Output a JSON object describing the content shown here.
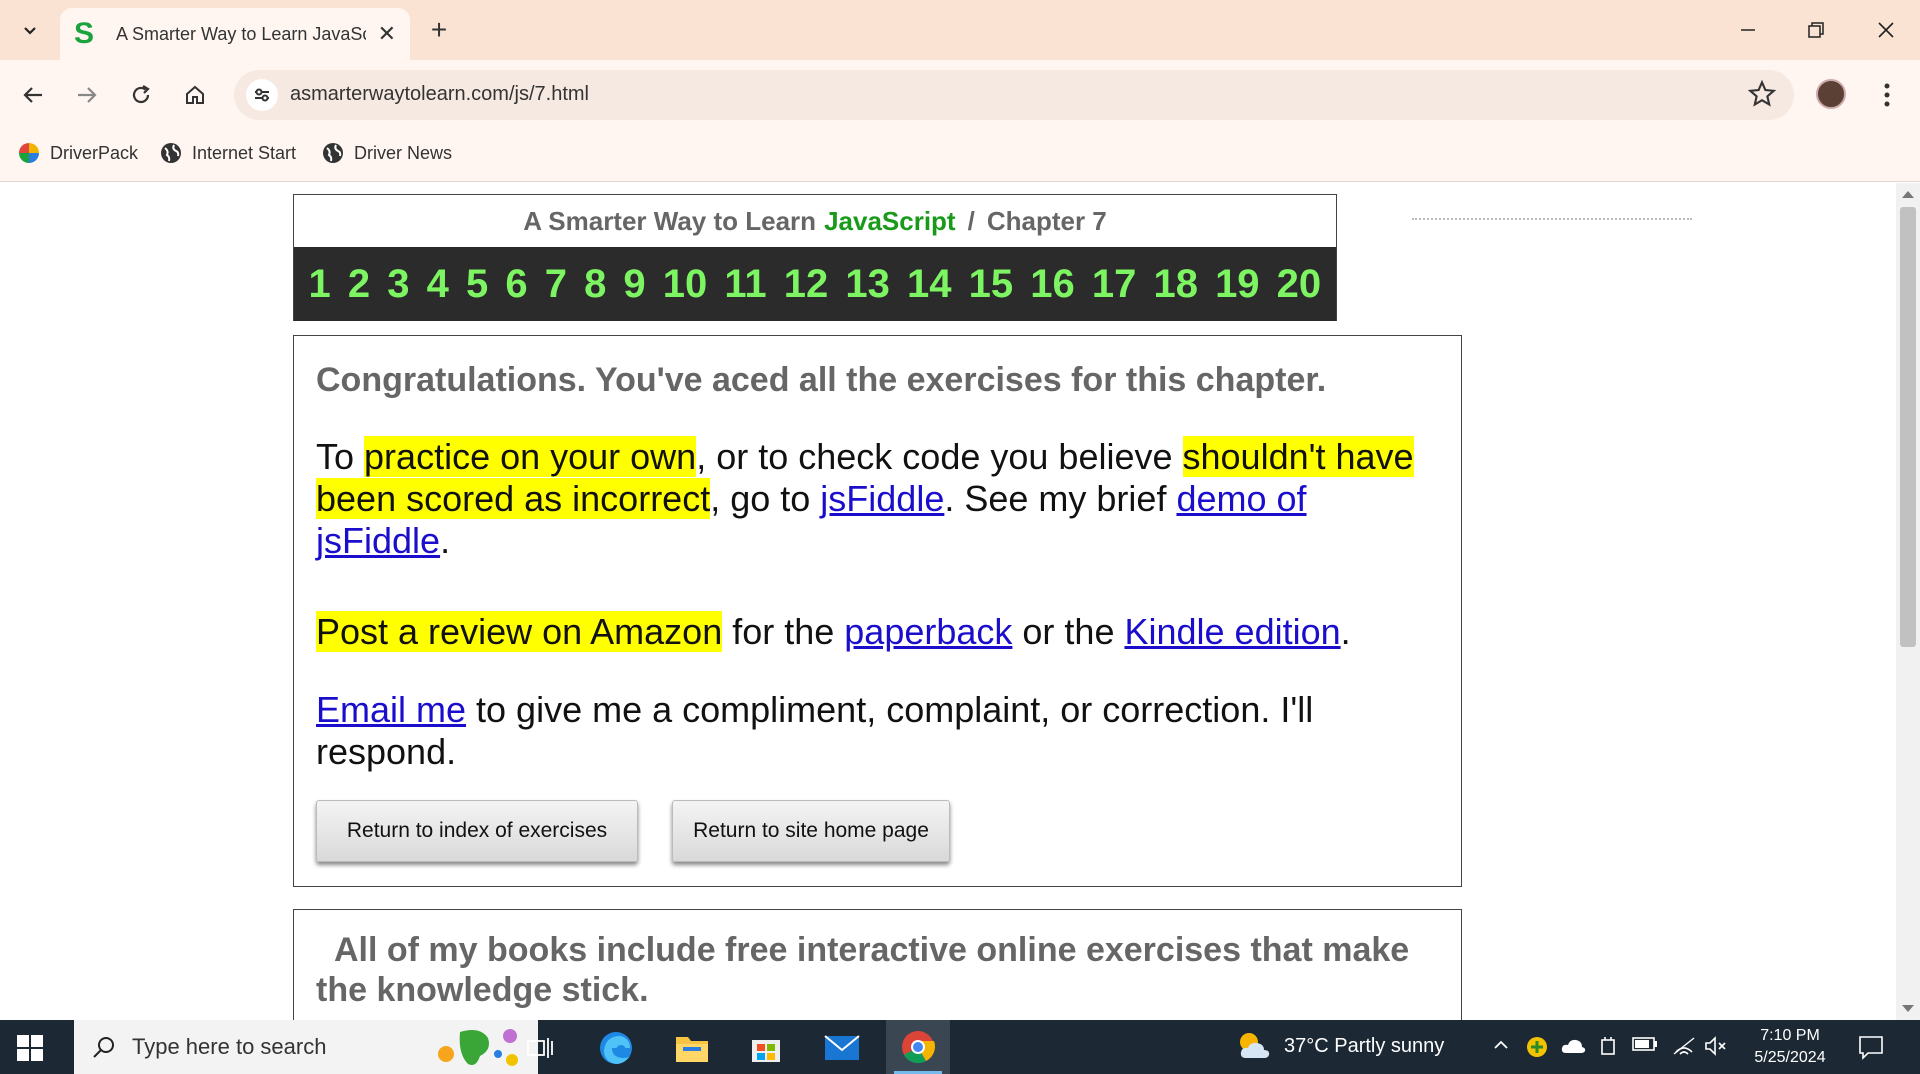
{
  "browser": {
    "tab_title": "A Smarter Way to Learn JavaScri",
    "tab_favicon": "S",
    "url": "asmarterwaytolearn.com/js/7.html",
    "bookmarks": [
      {
        "label": "DriverPack",
        "icon": "driverpack-icon"
      },
      {
        "label": "Internet Start",
        "icon": "globe-icon"
      },
      {
        "label": "Driver News",
        "icon": "globe-icon"
      }
    ]
  },
  "page": {
    "header": {
      "prefix": "A Smarter Way to Learn",
      "js": "JavaScript",
      "sep": "/",
      "chapter": "Chapter 7",
      "numbers": [
        "1",
        "2",
        "3",
        "4",
        "5",
        "6",
        "7",
        "8",
        "9",
        "10",
        "11",
        "12",
        "13",
        "14",
        "15",
        "16",
        "17",
        "18",
        "19",
        "20"
      ]
    },
    "congrats": {
      "heading": "Congratulations. You've aced all the exercises for this chapter.",
      "p1": {
        "t1": "To ",
        "h1": "practice on your own",
        "t2": ", or to check code you believe ",
        "h2": "shouldn't have been scored as incorrect",
        "t3": ", go to ",
        "link1": "jsFiddle",
        "t4": ". See my brief ",
        "link2": "demo of jsFiddle",
        "t5": "."
      },
      "p2": {
        "h1": "Post a review on Amazon",
        "t1": " for the ",
        "link1": "paperback",
        "t2": " or the ",
        "link2": "Kindle edition",
        "t3": "."
      },
      "p3": {
        "link1": "Email me",
        "t1": " to give me a compliment, complaint, or correction. I'll respond."
      },
      "buttons": {
        "index": "Return to index of exercises",
        "home": "Return to site home page"
      }
    },
    "books": {
      "text": "All of my books include free interactive online exercises that make the knowledge stick."
    }
  },
  "taskbar": {
    "search_placeholder": "Type here to search",
    "weather": "37°C  Partly sunny",
    "time": "7:10 PM",
    "date": "5/25/2024"
  },
  "colors": {
    "tab_strip": "#fbe3d3",
    "number_green": "#7df562",
    "js_green": "#1a9a1a",
    "highlight": "#ffff00",
    "link": "#1a0dcc"
  }
}
